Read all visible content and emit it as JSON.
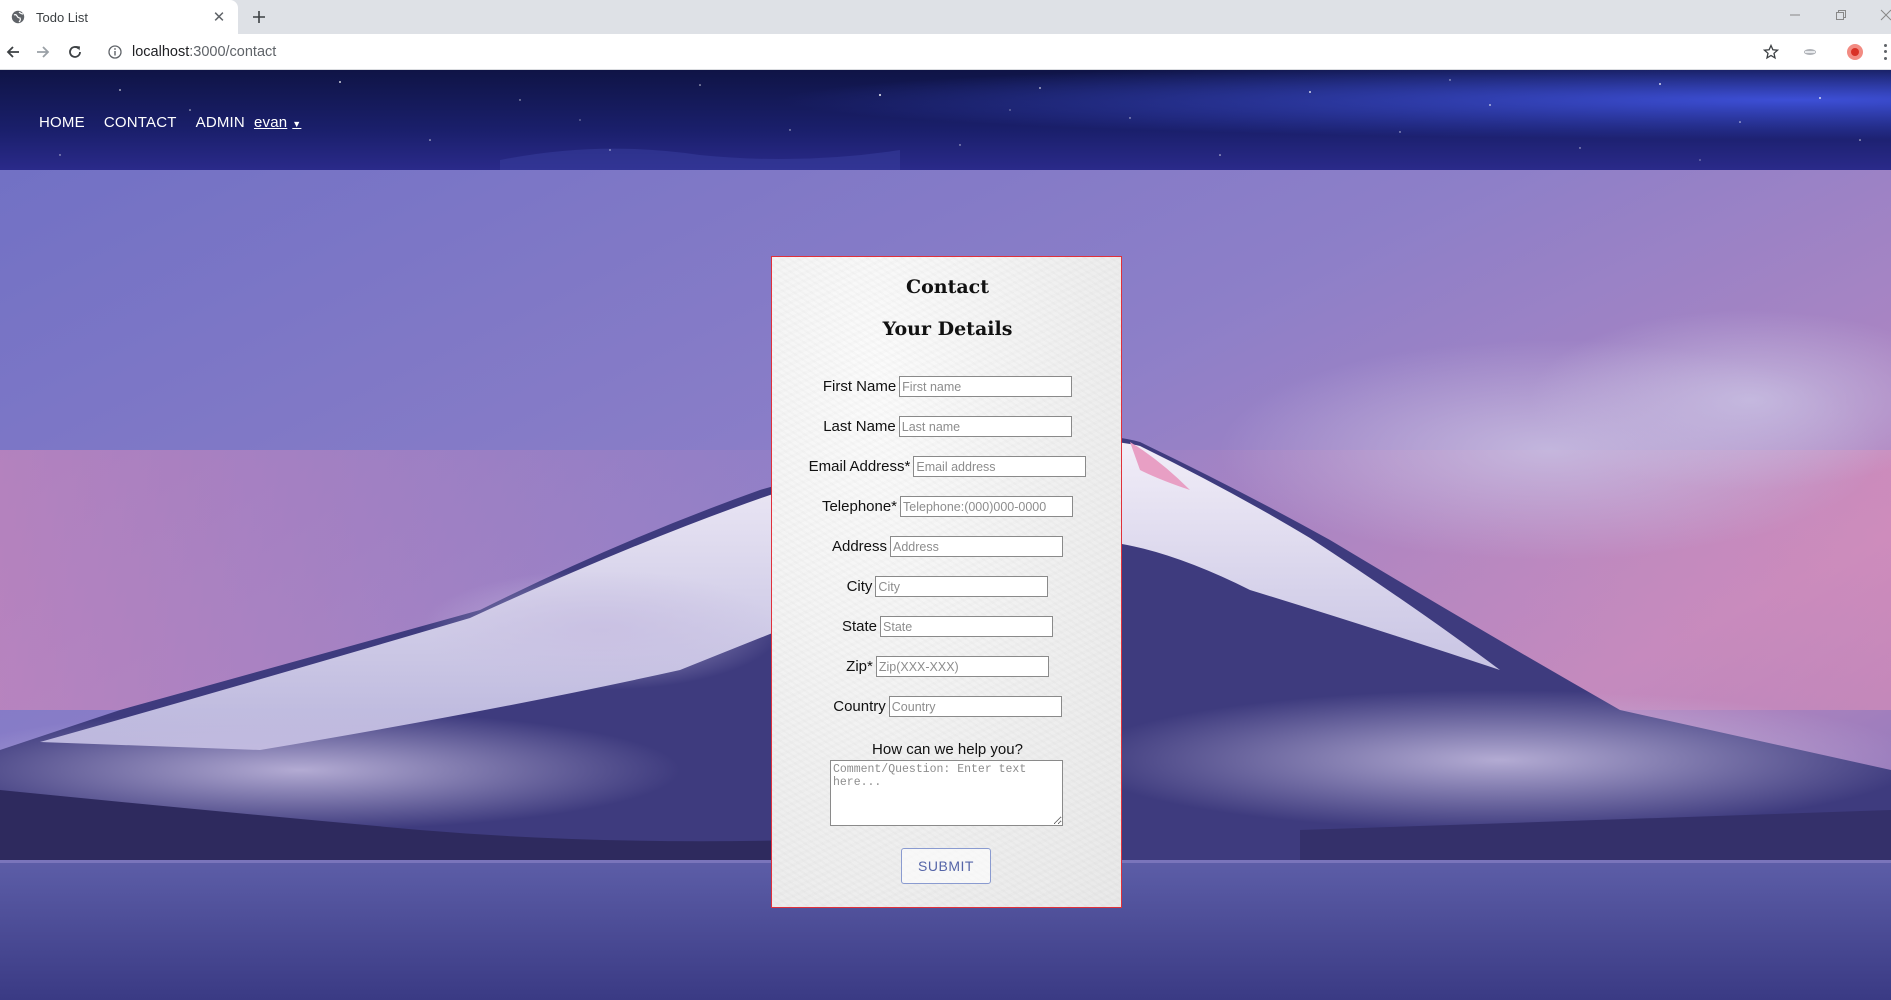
{
  "browser": {
    "tab_title": "Todo List",
    "url_host": "localhost",
    "url_path": ":3000/contact"
  },
  "nav": {
    "home": "HOME",
    "contact": "CONTACT",
    "admin": "ADMIN",
    "user": "evan",
    "caret": "▼"
  },
  "contact": {
    "title": "Contact",
    "subtitle": "Your Details",
    "fields": {
      "first_name": {
        "label": "First Name",
        "placeholder": "First name"
      },
      "last_name": {
        "label": "Last Name",
        "placeholder": "Last name"
      },
      "email": {
        "label": "Email Address*",
        "placeholder": "Email address"
      },
      "telephone": {
        "label": "Telephone*",
        "placeholder": "Telephone:(000)000-0000"
      },
      "address": {
        "label": "Address",
        "placeholder": "Address"
      },
      "city": {
        "label": "City",
        "placeholder": "City"
      },
      "state": {
        "label": "State",
        "placeholder": "State"
      },
      "zip": {
        "label": "Zip*",
        "placeholder": "Zip(XXX-XXX)"
      },
      "country": {
        "label": "Country",
        "placeholder": "Country"
      }
    },
    "help_label": "How can we help you?",
    "comment_placeholder": "Comment/Question: Enter text here...",
    "submit_label": "SUBMIT"
  },
  "colors": {
    "card_border": "#e0303a",
    "submit_text": "#5565a8"
  }
}
